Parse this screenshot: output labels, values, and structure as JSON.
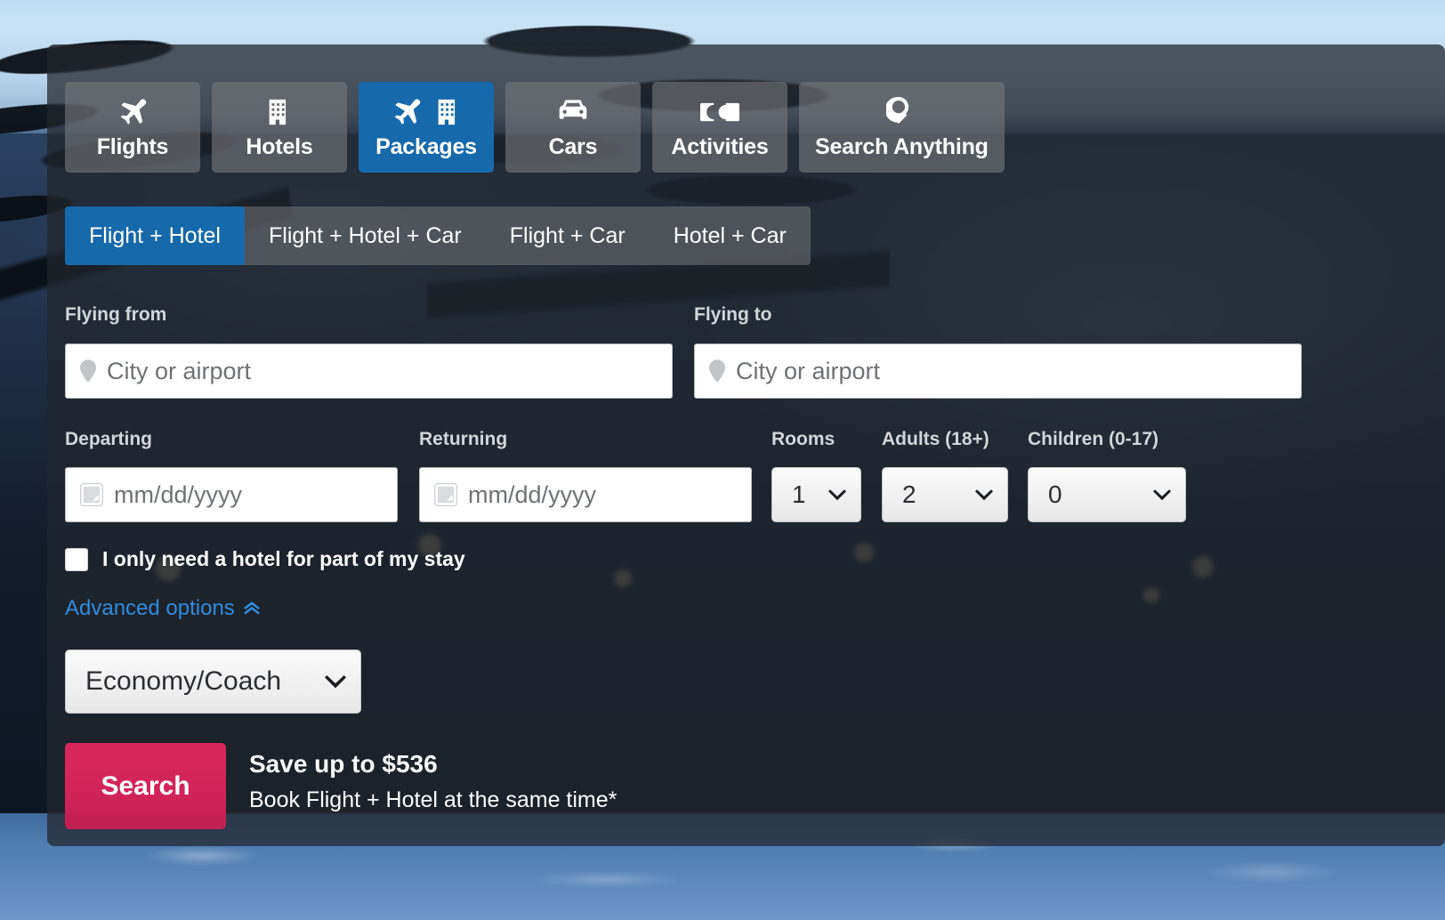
{
  "product_tabs": [
    {
      "label": "Flights",
      "icon": "plane-icon",
      "active": false
    },
    {
      "label": "Hotels",
      "icon": "hotel-building-icon",
      "active": false
    },
    {
      "label": "Packages",
      "icon": "plane-hotel-icon",
      "active": true
    },
    {
      "label": "Cars",
      "icon": "car-icon",
      "active": false
    },
    {
      "label": "Activities",
      "icon": "ticket-icon",
      "active": false
    },
    {
      "label": "Search Anything",
      "icon": "magnifier-icon",
      "active": false
    }
  ],
  "package_tabs": [
    {
      "label": "Flight + Hotel",
      "active": true
    },
    {
      "label": "Flight + Hotel + Car",
      "active": false
    },
    {
      "label": "Flight + Car",
      "active": false
    },
    {
      "label": "Hotel + Car",
      "active": false
    }
  ],
  "form": {
    "flying_from": {
      "label": "Flying from",
      "value": "",
      "placeholder": "City or airport",
      "icon": "map-pin-icon"
    },
    "flying_to": {
      "label": "Flying to",
      "value": "",
      "placeholder": "City or airport",
      "icon": "map-pin-icon"
    },
    "departing": {
      "label": "Departing",
      "value": "",
      "placeholder": "mm/dd/yyyy",
      "icon": "calendar-icon"
    },
    "returning": {
      "label": "Returning",
      "value": "",
      "placeholder": "mm/dd/yyyy",
      "icon": "calendar-icon"
    },
    "rooms": {
      "label": "Rooms",
      "value": "1"
    },
    "adults": {
      "label": "Adults (18+)",
      "value": "2"
    },
    "children": {
      "label": "Children (0-17)",
      "value": "0"
    },
    "partial_stay_checkbox": {
      "label": "I only need a hotel for part of my stay",
      "checked": false
    },
    "advanced_options": {
      "label": "Advanced options",
      "icon": "chevron-up-icon",
      "expanded": true
    },
    "cabin_class": {
      "value": "Economy/Coach"
    }
  },
  "actions": {
    "search_label": "Search"
  },
  "promo": {
    "headline": "Save up to $536",
    "subtext": "Book Flight + Hotel at the same time*"
  },
  "colors": {
    "accent_blue": "#1669ab",
    "search_pink": "#d2245a",
    "link_blue": "#2f8ce0",
    "panel_overlay": "rgba(34,38,44,0.74)"
  }
}
